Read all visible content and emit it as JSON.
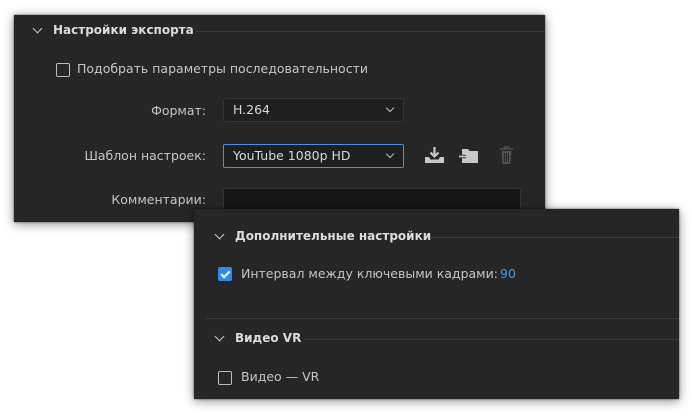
{
  "export_settings": {
    "section_title": "Настройки экспорта",
    "match_sequence_label": "Подобрать параметры последовательности",
    "match_sequence_checked": false,
    "format_label": "Формат:",
    "format_value": "H.264",
    "preset_label": "Шаблон настроек:",
    "preset_value": "YouTube 1080p HD",
    "comments_label": "Комментарии:",
    "comments_value": "",
    "preset_icons": [
      "save-preset-icon",
      "import-preset-icon",
      "delete-preset-icon"
    ]
  },
  "advanced_settings": {
    "section_title": "Дополнительные настройки",
    "keyframe_label": "Интервал между ключевыми кадрами:",
    "keyframe_checked": true,
    "keyframe_value": "90"
  },
  "vr_video": {
    "section_title": "Видео VR",
    "vr_label": "Видео — VR",
    "vr_checked": false
  },
  "colors": {
    "panel_bg": "#262626",
    "accent": "#2d8ceb",
    "value_blue": "#3a9ff0"
  }
}
